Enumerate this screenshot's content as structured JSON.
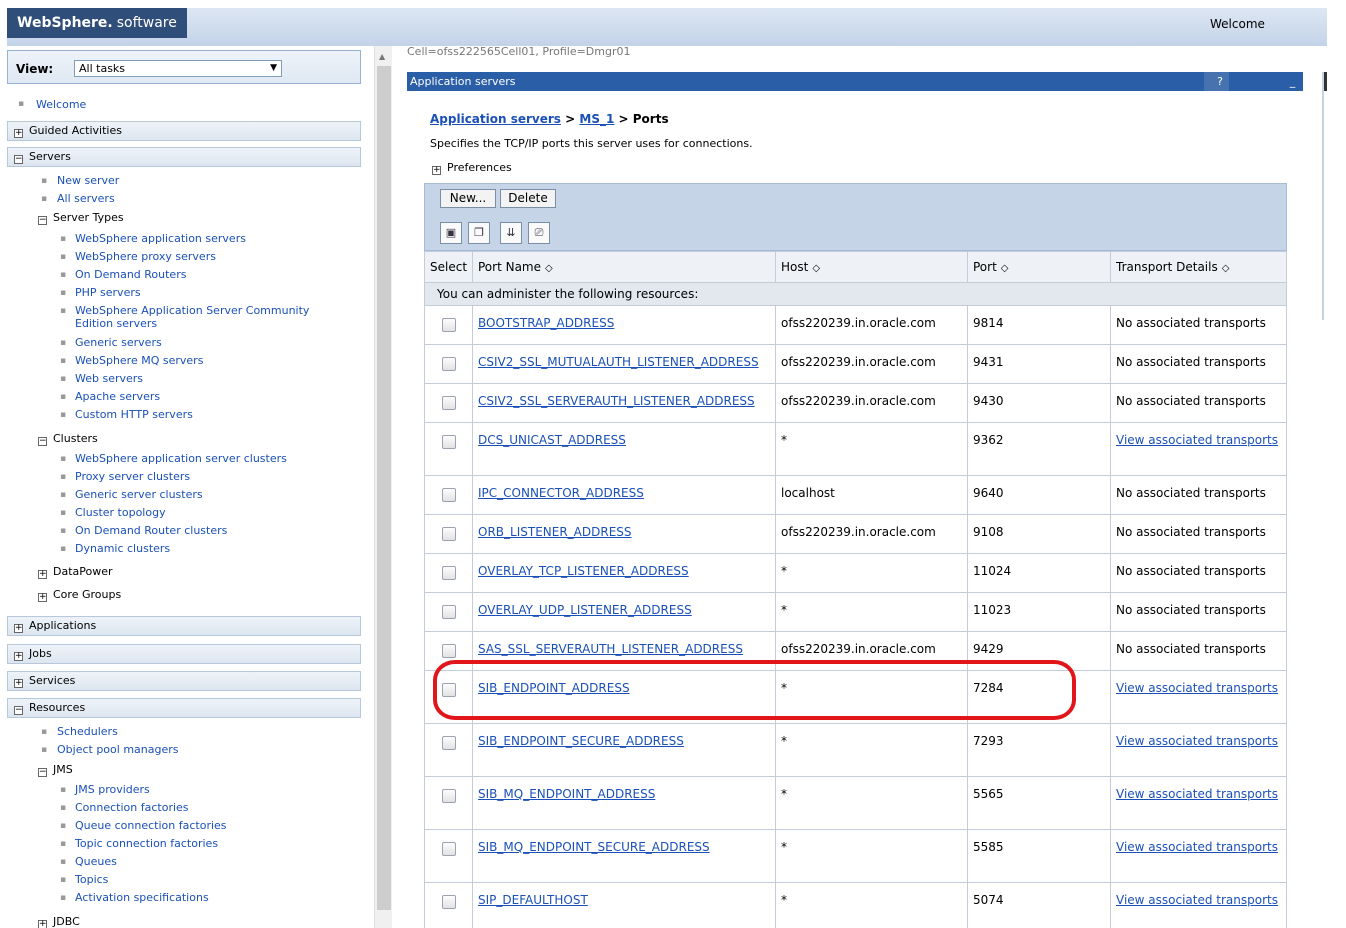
{
  "header": {
    "brand": "WebSphere.",
    "brand_suffix": "software",
    "welcome": "Welcome"
  },
  "nav": {
    "view_label": "View:",
    "view_value": "All tasks",
    "welcome_link": "Welcome",
    "guided": "Guided Activities",
    "servers": "Servers",
    "new_server": "New server",
    "all_servers": "All servers",
    "server_types": "Server Types",
    "st": [
      "WebSphere application servers",
      "WebSphere proxy servers",
      "On Demand Routers",
      "PHP servers",
      "WebSphere Application Server Community",
      "Edition servers",
      "Generic servers",
      "WebSphere MQ servers",
      "Web servers",
      "Apache servers",
      "Custom HTTP servers"
    ],
    "clusters": "Clusters",
    "cl": [
      "WebSphere application server clusters",
      "Proxy server clusters",
      "Generic server clusters",
      "Cluster topology",
      "On Demand Router clusters",
      "Dynamic clusters"
    ],
    "datapower": "DataPower",
    "core_groups": "Core Groups",
    "applications": "Applications",
    "jobs": "Jobs",
    "services": "Services",
    "resources": "Resources",
    "schedulers": "Schedulers",
    "object_pool": "Object pool managers",
    "jms": "JMS",
    "jms_items": [
      "JMS providers",
      "Connection factories",
      "Queue connection factories",
      "Topic connection factories",
      "Queues",
      "Topics",
      "Activation specifications"
    ],
    "jdbc": "JDBC"
  },
  "main": {
    "cell_info": "Cell=ofss222565Cell01, Profile=Dmgr01",
    "panel_title": "Application servers",
    "help": "?",
    "minimize": "_",
    "crumb1": "Application servers",
    "crumb2": "MS_1",
    "crumb_sep": ">",
    "crumb3": "Ports",
    "description": "Specifies the TCP/IP ports this server uses for connections.",
    "preferences": "Preferences",
    "new_btn": "New...",
    "delete_btn": "Delete"
  },
  "table": {
    "headers": {
      "select": "Select",
      "port_name": "Port Name",
      "host": "Host",
      "port": "Port",
      "transport": "Transport Details"
    },
    "info": "You can administer the following resources:",
    "rows": [
      {
        "name": "BOOTSTRAP_ADDRESS",
        "host": "ofss220239.in.oracle.com",
        "port": "9814",
        "transport": "No associated transports"
      },
      {
        "name": "CSIV2_SSL_MUTUALAUTH_LISTENER_ADDRESS",
        "host": "ofss220239.in.oracle.com",
        "port": "9431",
        "transport": "No associated transports"
      },
      {
        "name": "CSIV2_SSL_SERVERAUTH_LISTENER_ADDRESS",
        "host": "ofss220239.in.oracle.com",
        "port": "9430",
        "transport": "No associated transports"
      },
      {
        "name": "DCS_UNICAST_ADDRESS",
        "host": "*",
        "port": "9362",
        "transport": "View associated transports"
      },
      {
        "name": "IPC_CONNECTOR_ADDRESS",
        "host": "localhost",
        "port": "9640",
        "transport": "No associated transports"
      },
      {
        "name": "ORB_LISTENER_ADDRESS",
        "host": "ofss220239.in.oracle.com",
        "port": "9108",
        "transport": "No associated transports"
      },
      {
        "name": "OVERLAY_TCP_LISTENER_ADDRESS",
        "host": "*",
        "port": "11024",
        "transport": "No associated transports"
      },
      {
        "name": "OVERLAY_UDP_LISTENER_ADDRESS",
        "host": "*",
        "port": "11023",
        "transport": "No associated transports"
      },
      {
        "name": "SAS_SSL_SERVERAUTH_LISTENER_ADDRESS",
        "host": "ofss220239.in.oracle.com",
        "port": "9429",
        "transport": "No associated transports"
      },
      {
        "name": "SIB_ENDPOINT_ADDRESS",
        "host": "*",
        "port": "7284",
        "transport": "View associated transports"
      },
      {
        "name": "SIB_ENDPOINT_SECURE_ADDRESS",
        "host": "*",
        "port": "7293",
        "transport": "View associated transports"
      },
      {
        "name": "SIB_MQ_ENDPOINT_ADDRESS",
        "host": "*",
        "port": "5565",
        "transport": "View associated transports"
      },
      {
        "name": "SIB_MQ_ENDPOINT_SECURE_ADDRESS",
        "host": "*",
        "port": "5585",
        "transport": "View associated transports"
      },
      {
        "name": "SIP_DEFAULTHOST",
        "host": "*",
        "port": "5074",
        "transport": "View associated transports"
      }
    ]
  }
}
